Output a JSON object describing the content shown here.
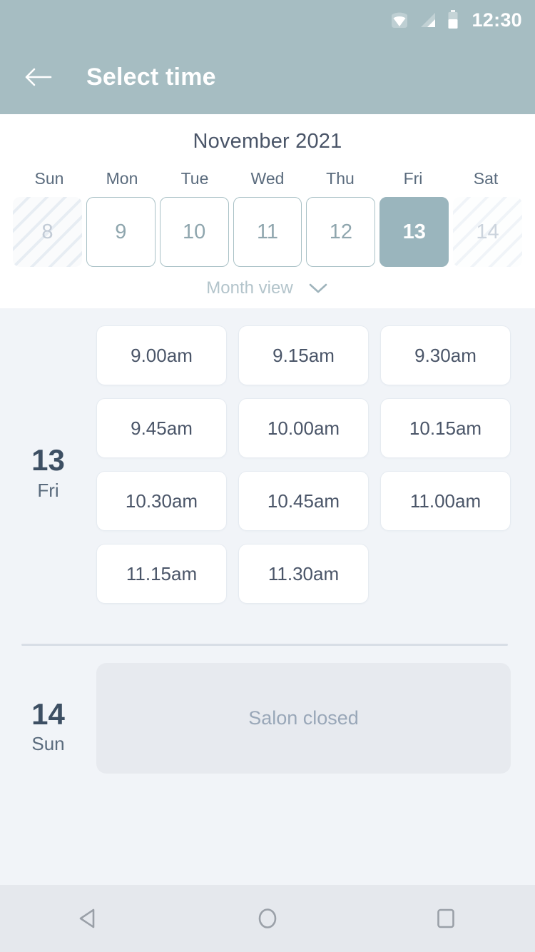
{
  "status_bar": {
    "time": "12:30",
    "icons": [
      "wifi-icon",
      "cellular-signal-icon",
      "battery-icon"
    ]
  },
  "app_bar": {
    "title": "Select time",
    "back_icon": "back-arrow-icon"
  },
  "calendar": {
    "month_label": "November 2021",
    "weekdays": [
      "Sun",
      "Mon",
      "Tue",
      "Wed",
      "Thu",
      "Fri",
      "Sat"
    ],
    "days": [
      {
        "number": "8",
        "state": "disabled"
      },
      {
        "number": "9",
        "state": "available"
      },
      {
        "number": "10",
        "state": "available"
      },
      {
        "number": "11",
        "state": "available"
      },
      {
        "number": "12",
        "state": "available"
      },
      {
        "number": "13",
        "state": "selected"
      },
      {
        "number": "14",
        "state": "disabled-light"
      }
    ],
    "month_view": {
      "label": "Month view",
      "chevron_icon": "chevron-down-icon"
    }
  },
  "day_groups": [
    {
      "day_number": "13",
      "day_name": "Fri",
      "slots": [
        "9.00am",
        "9.15am",
        "9.30am",
        "9.45am",
        "10.00am",
        "10.15am",
        "10.30am",
        "10.45am",
        "11.00am",
        "11.15am",
        "11.30am"
      ]
    },
    {
      "day_number": "14",
      "day_name": "Sun",
      "closed_message": "Salon closed"
    }
  ],
  "nav_bar": {
    "back_label": "back-triangle-icon",
    "home_label": "home-circle-icon",
    "recents_label": "recents-square-icon"
  },
  "colors": {
    "header": "#a6bdc2",
    "selected_day": "#9ab5bd",
    "page_background": "#f1f4f8",
    "card": "#ffffff",
    "text_primary": "#4a5568",
    "text_muted": "#99a7b8"
  }
}
